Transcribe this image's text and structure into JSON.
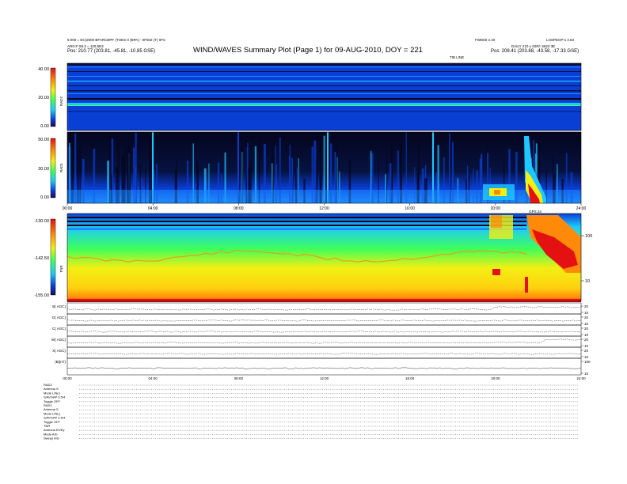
{
  "header": {
    "title": "WIND/WAVES Summary Plot (Page 1) for 09-AUG-2010, DOY = 221",
    "left_line1": "9.000 = EC(2000 BFARCBPF (TOES 0 (BPA) - 0F502 (T) 0FC",
    "left_line2": "ARG:F 59.3 = 120.5E3",
    "left_pos": "Pos:   210.77 (203.81, -45.81, -10.85 GSE)",
    "right_line1": "FWD60 2.40",
    "right_line2": "LOSPEOP:s 3.63",
    "right_line3": "DAILY 210 ± 02R/: 6623 3E",
    "right_pos": "Pos:   208.41 (203.88, -43.58, -17.33 GSE)",
    "time_note": "TIB LINE"
  },
  "chart_data": [
    {
      "type": "heatmap",
      "panel": "RAD2",
      "colorbar_ticks": [
        "40.00",
        "20.00",
        "0.00"
      ],
      "ylabel": "RAD2"
    },
    {
      "type": "heatmap",
      "panel": "RAD1",
      "colorbar_ticks": [
        "50.00",
        "30.00",
        "0.00"
      ],
      "ylabel": "RAD1",
      "x_ticks": [
        "00:00",
        "04:00",
        "08:00",
        "12:00",
        "16:00",
        "20:00",
        "24:00"
      ],
      "x_note": "GPS 24"
    },
    {
      "type": "heatmap",
      "panel": "TNR",
      "colorbar_ticks": [
        "-130.00",
        "-142.50",
        "-155.00"
      ],
      "ylabel": "TNR",
      "right_axis_ticks": [
        "100",
        "10"
      ]
    },
    {
      "type": "line",
      "panel": "MFI/SWE parameters",
      "rows": [
        {
          "label": "B( AGC)",
          "right_ticks": [
            "20",
            "10"
          ]
        },
        {
          "label": "G( AGC)",
          "right_ticks": [
            "20",
            "10"
          ]
        },
        {
          "label": "C( AGC)",
          "right_ticks": [
            "20",
            "10"
          ]
        },
        {
          "label": "W( AGC)",
          "right_ticks": [
            "20",
            "10"
          ]
        },
        {
          "label": "X( AGC)",
          "right_ticks": [
            "20",
            "10"
          ]
        },
        {
          "label": "|B|(nT)",
          "right_ticks": [
            "100",
            "10"
          ]
        }
      ],
      "x_ticks": [
        "00:00",
        "04:00",
        "08:00",
        "12:00",
        "16:00",
        "20:00",
        "24:00"
      ]
    }
  ],
  "footer": {
    "lines": [
      "RAD2",
      "Antenna  S",
      "Mode  LIN(-)",
      "S/AVGAP  3.5/4",
      "Toggle   OFF",
      "RAD1",
      "Antenna  S",
      "Mode  LIN(-)",
      "S/AVGAP  3.5/4",
      "Toggle   OFF",
      "TNR",
      "Antenna  Ex/Ey",
      "Mode  A/D",
      "Sweep  A/D"
    ]
  },
  "colors": {
    "bg_blue": "#0a3fd6",
    "dark": "#05051e",
    "cyan": "#1ec8ff",
    "green": "#3dff5a",
    "yellow": "#f2ef12",
    "orange": "#ff8a0a",
    "red": "#e31111"
  }
}
